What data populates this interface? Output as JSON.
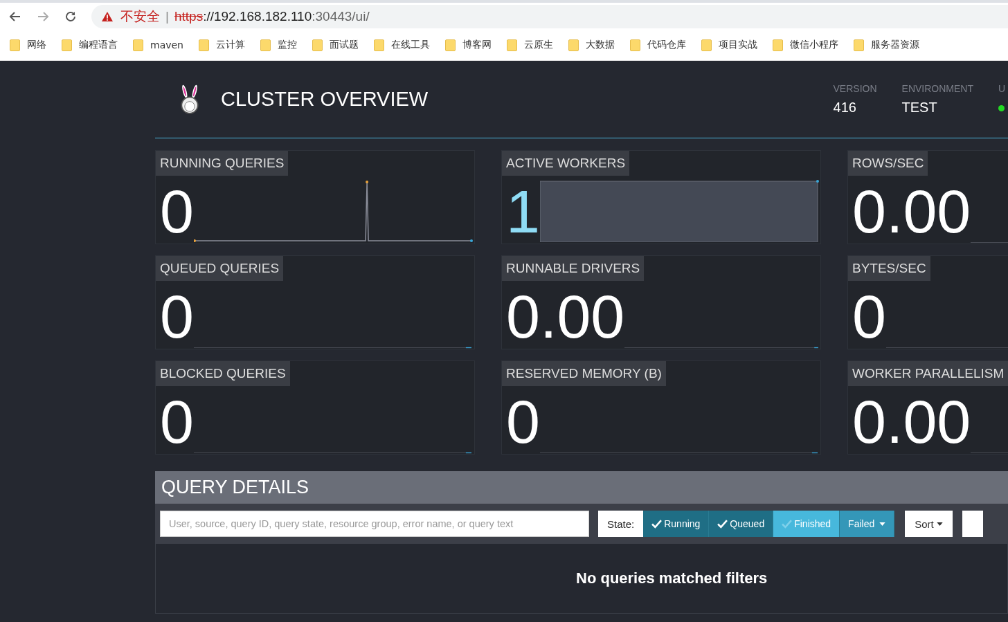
{
  "browser": {
    "security_warning": "不安全",
    "separator": "|",
    "url_scheme": "https",
    "url_rest": "://192.168.182.110",
    "url_port": ":30443/ui/"
  },
  "bookmarks": [
    "网络",
    "编程语言",
    "maven",
    "云计算",
    "监控",
    "面试题",
    "在线工具",
    "博客网",
    "云原生",
    "大数据",
    "代码仓库",
    "项目实战",
    "微信小程序",
    "服务器资源"
  ],
  "header": {
    "title": "CLUSTER OVERVIEW",
    "info": [
      {
        "label": "VERSION",
        "value": "416"
      },
      {
        "label": "ENVIRONMENT",
        "value": "TEST"
      },
      {
        "label": "U",
        "on": true
      }
    ]
  },
  "metrics": [
    {
      "label": "RUNNING QUERIES",
      "value": "0",
      "kind": "spike"
    },
    {
      "label": "ACTIVE WORKERS",
      "value": "1",
      "kind": "area"
    },
    {
      "label": "ROWS/SEC",
      "value": "0.00",
      "kind": "flat"
    },
    {
      "label": "QUEUED QUERIES",
      "value": "0",
      "kind": "flat"
    },
    {
      "label": "RUNNABLE DRIVERS",
      "value": "0.00",
      "kind": "flat"
    },
    {
      "label": "BYTES/SEC",
      "value": "0",
      "kind": "flat"
    },
    {
      "label": "BLOCKED QUERIES",
      "value": "0",
      "kind": "flat"
    },
    {
      "label": "RESERVED MEMORY (B)",
      "value": "0",
      "kind": "flat"
    },
    {
      "label": "WORKER PARALLELISM",
      "value": "0.00",
      "kind": "flat"
    }
  ],
  "query_details": {
    "title": "QUERY DETAILS",
    "search": {
      "placeholder": "User, source, query ID, query state, resource group, error name, or query text"
    },
    "state_label": "State:",
    "state_filters": [
      {
        "label": "Running",
        "kind": "toggle",
        "checked": true
      },
      {
        "label": "Queued",
        "kind": "toggle",
        "checked": true
      },
      {
        "label": "Finished",
        "kind": "toggle",
        "checked": false
      },
      {
        "label": "Failed",
        "kind": "dropdown",
        "checked": false
      }
    ],
    "sort": "Sort",
    "empty_message": "No queries matched filters"
  }
}
